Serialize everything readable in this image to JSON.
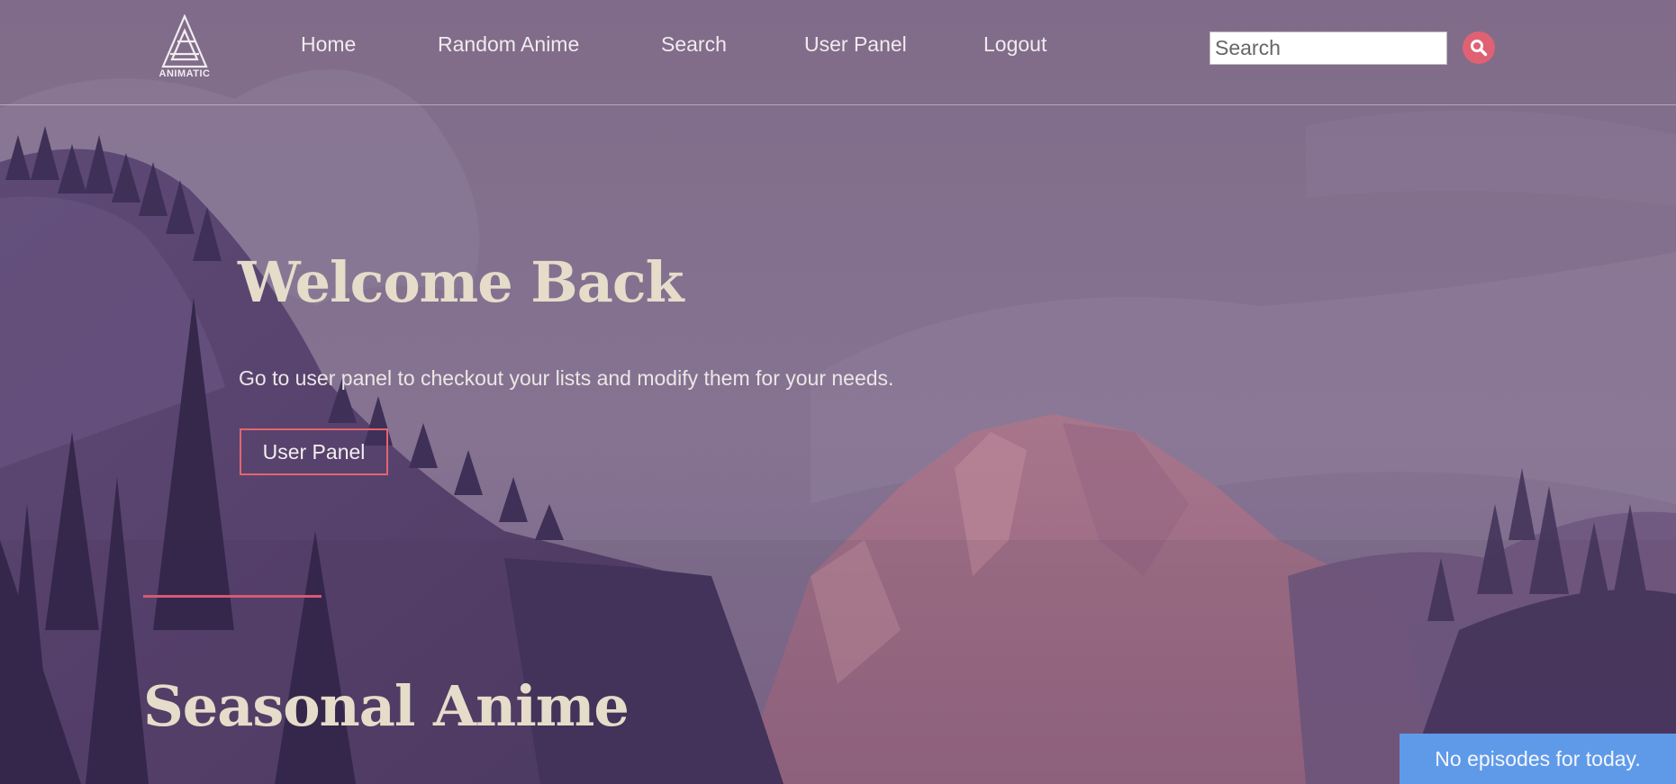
{
  "brand": {
    "logo_text": "ANIMATIC"
  },
  "nav": {
    "items": [
      {
        "label": "Home"
      },
      {
        "label": "Random Anime"
      },
      {
        "label": "Search"
      },
      {
        "label": "User Panel"
      },
      {
        "label": "Logout"
      }
    ]
  },
  "search": {
    "placeholder": "Search",
    "value": ""
  },
  "hero": {
    "title": "Welcome Back",
    "subtitle": "Go to user panel to checkout your lists and modify them for your needs.",
    "button_label": "User Panel"
  },
  "seasonal": {
    "title": "Seasonal Anime"
  },
  "toast": {
    "message": "No episodes for today."
  },
  "colors": {
    "accent": "#e06173",
    "heading": "#e6dcca",
    "toast_bg": "#5f9ae9",
    "overlay": "#7d6a86"
  },
  "icons": {
    "logo": "animatic-logo-icon",
    "search_button": "search-icon"
  }
}
